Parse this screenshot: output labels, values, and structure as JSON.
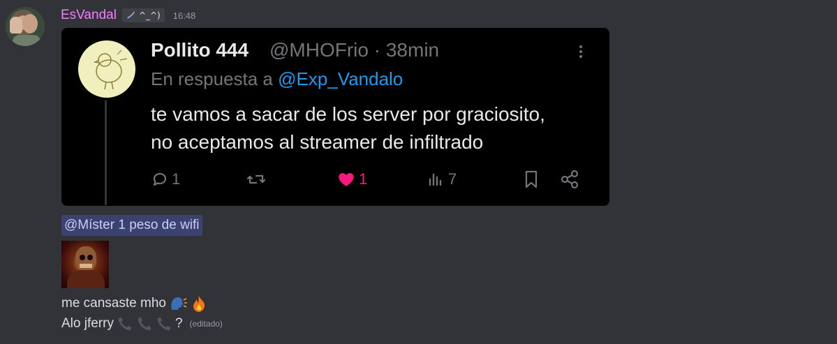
{
  "message": {
    "username": "EsVandal",
    "tag": "^_^)",
    "timestamp": "16:48"
  },
  "tweet": {
    "display_name": "Pollito 444",
    "handle_time": "@MHOFrio · 38min",
    "reply_prefix": "En respuesta a",
    "reply_mention": "@Exp_Vandalo",
    "body_line1": "te vamos a sacar de los server por graciosito,",
    "body_line2": "no aceptamos al streamer de infiltrado",
    "replies": "1",
    "likes": "1",
    "views": "7"
  },
  "mention": "@Míster 1 peso de wifi",
  "lines": {
    "line1": "me cansaste mho",
    "line2_text": "Alo jferry",
    "line2_suffix": "?",
    "edited": "(editado)"
  },
  "colors": {
    "background": "#313338",
    "username": "#f47fff",
    "tweet_bg": "#000000",
    "link": "#1d9bf0",
    "like": "#f91880",
    "mention_bg": "#3c4270"
  }
}
